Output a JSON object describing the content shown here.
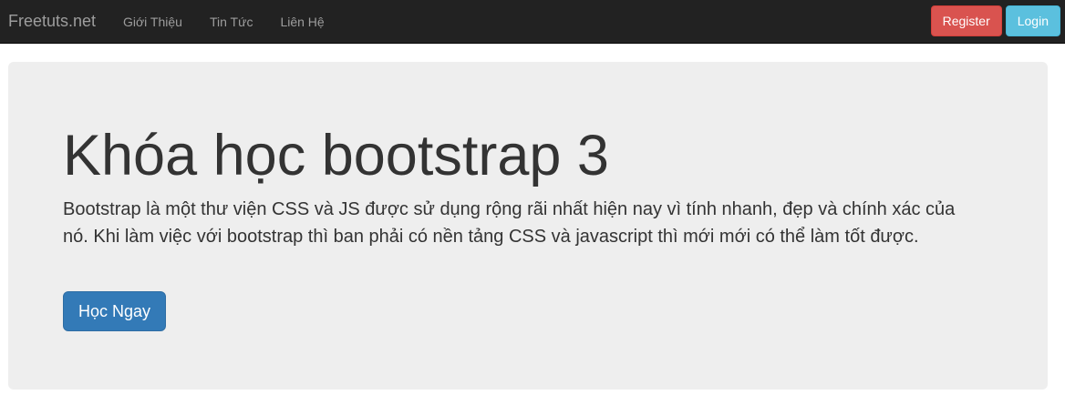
{
  "navbar": {
    "brand": "Freetuts.net",
    "links": [
      "Giới Thiệu",
      "Tin Tức",
      "Liên Hệ"
    ],
    "register_label": "Register",
    "login_label": "Login"
  },
  "jumbotron": {
    "title": "Khóa học bootstrap 3",
    "description": "Bootstrap là một thư viện CSS và JS được sử dụng rộng rãi nhất hiện nay vì tính nhanh, đẹp và chính xác của nó. Khi làm việc với bootstrap thì ban phải có nền tảng CSS và javascript thì mới mới có thể làm tốt được.",
    "button_label": "Học Ngay"
  },
  "colors": {
    "navbar_bg": "#222222",
    "jumbotron_bg": "#eeeeee",
    "register_bg": "#d9534f",
    "login_bg": "#5bc0de",
    "primary_bg": "#337ab7"
  }
}
